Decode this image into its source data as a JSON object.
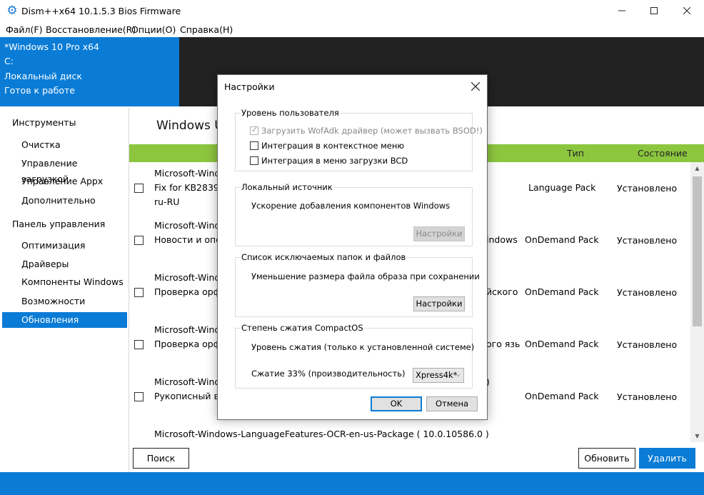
{
  "window": {
    "title": "Dism++x64 10.1.5.3 Bios Firmware",
    "minimize": "─",
    "maximize": "☐",
    "close": "✕"
  },
  "menu": [
    "Файл(F)",
    "Восстановление(R)",
    "Опции(O)",
    "Справка(H)"
  ],
  "header": {
    "lines": [
      "*Windows 10 Pro x64",
      "C:",
      "Локальный диск",
      "Готов к работе"
    ]
  },
  "sidebar": {
    "groups": [
      {
        "label": "Инструменты",
        "items": [
          "Очистка",
          "Управление загрузкой",
          "Управление Appx",
          "Дополнительно"
        ]
      },
      {
        "label": "Панель управления",
        "items": [
          "Оптимизация",
          "Драйверы",
          "Компоненты Windows",
          "Возможности",
          "Обновления"
        ]
      }
    ],
    "selected": "Обновления"
  },
  "main": {
    "heading": "Windows U",
    "columns": {
      "type": "Тип",
      "status": "Состояние"
    },
    "rows": [
      {
        "lines": [
          "Microsoft-Wind",
          "Fix for KB28396",
          "ru-RU"
        ],
        "type": "Language Pack",
        "status": "Установлено"
      },
      {
        "lines": [
          "Microsoft-Wind",
          "Новости и опов"
        ],
        "extra": "indows",
        "type": "OnDemand Pack",
        "status": "Установлено"
      },
      {
        "lines": [
          "Microsoft-Wind",
          "Проверка орфо"
        ],
        "extra": "йского",
        "type": "OnDemand Pack",
        "status": "Установлено"
      },
      {
        "lines": [
          "Microsoft-Wind",
          "Проверка орфо"
        ],
        "extra": "ого язь",
        "type": "OnDemand Pack",
        "status": "Установлено"
      },
      {
        "lines": [
          "Microsoft-Wind",
          "Рукописный вво"
        ],
        "extra": ")",
        "type": "OnDemand Pack",
        "status": "Установлено"
      }
    ],
    "last_row": "Microsoft-Windows-LanguageFeatures-OCR-en-us-Package ( 10.0.10586.0 )",
    "buttons": {
      "search": "Поиск",
      "refresh": "Обновить",
      "delete": "Удалить"
    }
  },
  "dialog": {
    "title": "Настройки",
    "close": "✕",
    "user_level": {
      "legend": "Уровень пользователя",
      "options": [
        {
          "label": "Загрузить WofAdk драйвер (может вызвать BSOD!)",
          "checked": true,
          "disabled": true
        },
        {
          "label": "Интеграция в контекстное меню",
          "checked": false,
          "disabled": false
        },
        {
          "label": "Интеграция в меню загрузки BCD",
          "checked": false,
          "disabled": false
        }
      ]
    },
    "local_source": {
      "legend": "Локальный источник",
      "text": "Ускорение добавления компонентов Windows",
      "button": "Настройки"
    },
    "exclusions": {
      "legend": "Список исключаемых папок и файлов",
      "text": "Уменьшение размера файла образа при сохранении",
      "button": "Настройки"
    },
    "compactos": {
      "legend": "Степень сжатия CompactOS",
      "text1": "Уровень сжатия (только к установленной системе)",
      "text2": "Сжатие 33% (производительность)",
      "select_value": "Xpress4k*"
    },
    "ok": "OK",
    "cancel": "Отмена"
  },
  "colors": {
    "accent": "#0a7cd6",
    "column_bar": "#8cc63f",
    "dark_header": "#222222"
  }
}
